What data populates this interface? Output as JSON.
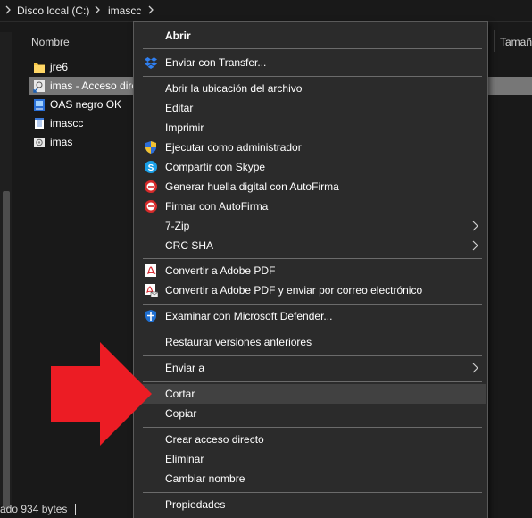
{
  "breadcrumb": {
    "drive": "Disco local (C:)",
    "folder": "imascc"
  },
  "columns": {
    "name": "Nombre",
    "size": "Tamañ"
  },
  "files": [
    {
      "name": "jre6",
      "icon": "folder-icon"
    },
    {
      "name": "imas - Acceso dire",
      "icon": "shortcut-icon",
      "selected": true
    },
    {
      "name": "OAS negro OK",
      "icon": "image-icon"
    },
    {
      "name": "imascc",
      "icon": "text-file-icon"
    },
    {
      "name": "imas",
      "icon": "photo-icon"
    }
  ],
  "status": {
    "text": "ado   934 bytes"
  },
  "context_menu": {
    "items": [
      {
        "label": "Abrir",
        "bold": true
      },
      {
        "label": "Enviar con Transfer...",
        "icon": "dropbox-icon"
      },
      {
        "label": "Abrir la ubicación del archivo"
      },
      {
        "label": "Editar"
      },
      {
        "label": "Imprimir"
      },
      {
        "label": "Ejecutar como administrador",
        "icon": "uac-shield-icon"
      },
      {
        "label": "Compartir con Skype",
        "icon": "skype-icon"
      },
      {
        "label": "Generar huella digital con AutoFirma",
        "icon": "autofirma-icon"
      },
      {
        "label": "Firmar con AutoFirma",
        "icon": "autofirma-icon"
      },
      {
        "label": "7-Zip",
        "submenu": true
      },
      {
        "label": "CRC SHA",
        "submenu": true
      },
      {
        "label": "Convertir a Adobe PDF",
        "icon": "adobe-pdf-icon"
      },
      {
        "label": "Convertir a Adobe PDF y enviar por correo electrónico",
        "icon": "adobe-pdf-mail-icon"
      },
      {
        "label": "Examinar con Microsoft Defender...",
        "icon": "defender-icon"
      },
      {
        "label": "Restaurar versiones anteriores"
      },
      {
        "label": "Enviar a",
        "submenu": true
      },
      {
        "label": "Cortar",
        "highlighted": true
      },
      {
        "label": "Copiar"
      },
      {
        "label": "Crear acceso directo"
      },
      {
        "label": "Eliminar"
      },
      {
        "label": "Cambiar nombre"
      },
      {
        "label": "Propiedades"
      }
    ]
  },
  "colors": {
    "menu_bg": "#2b2b2b",
    "highlight": "#414141",
    "selected_row": "#777777",
    "arrow": "#ec1c24"
  }
}
